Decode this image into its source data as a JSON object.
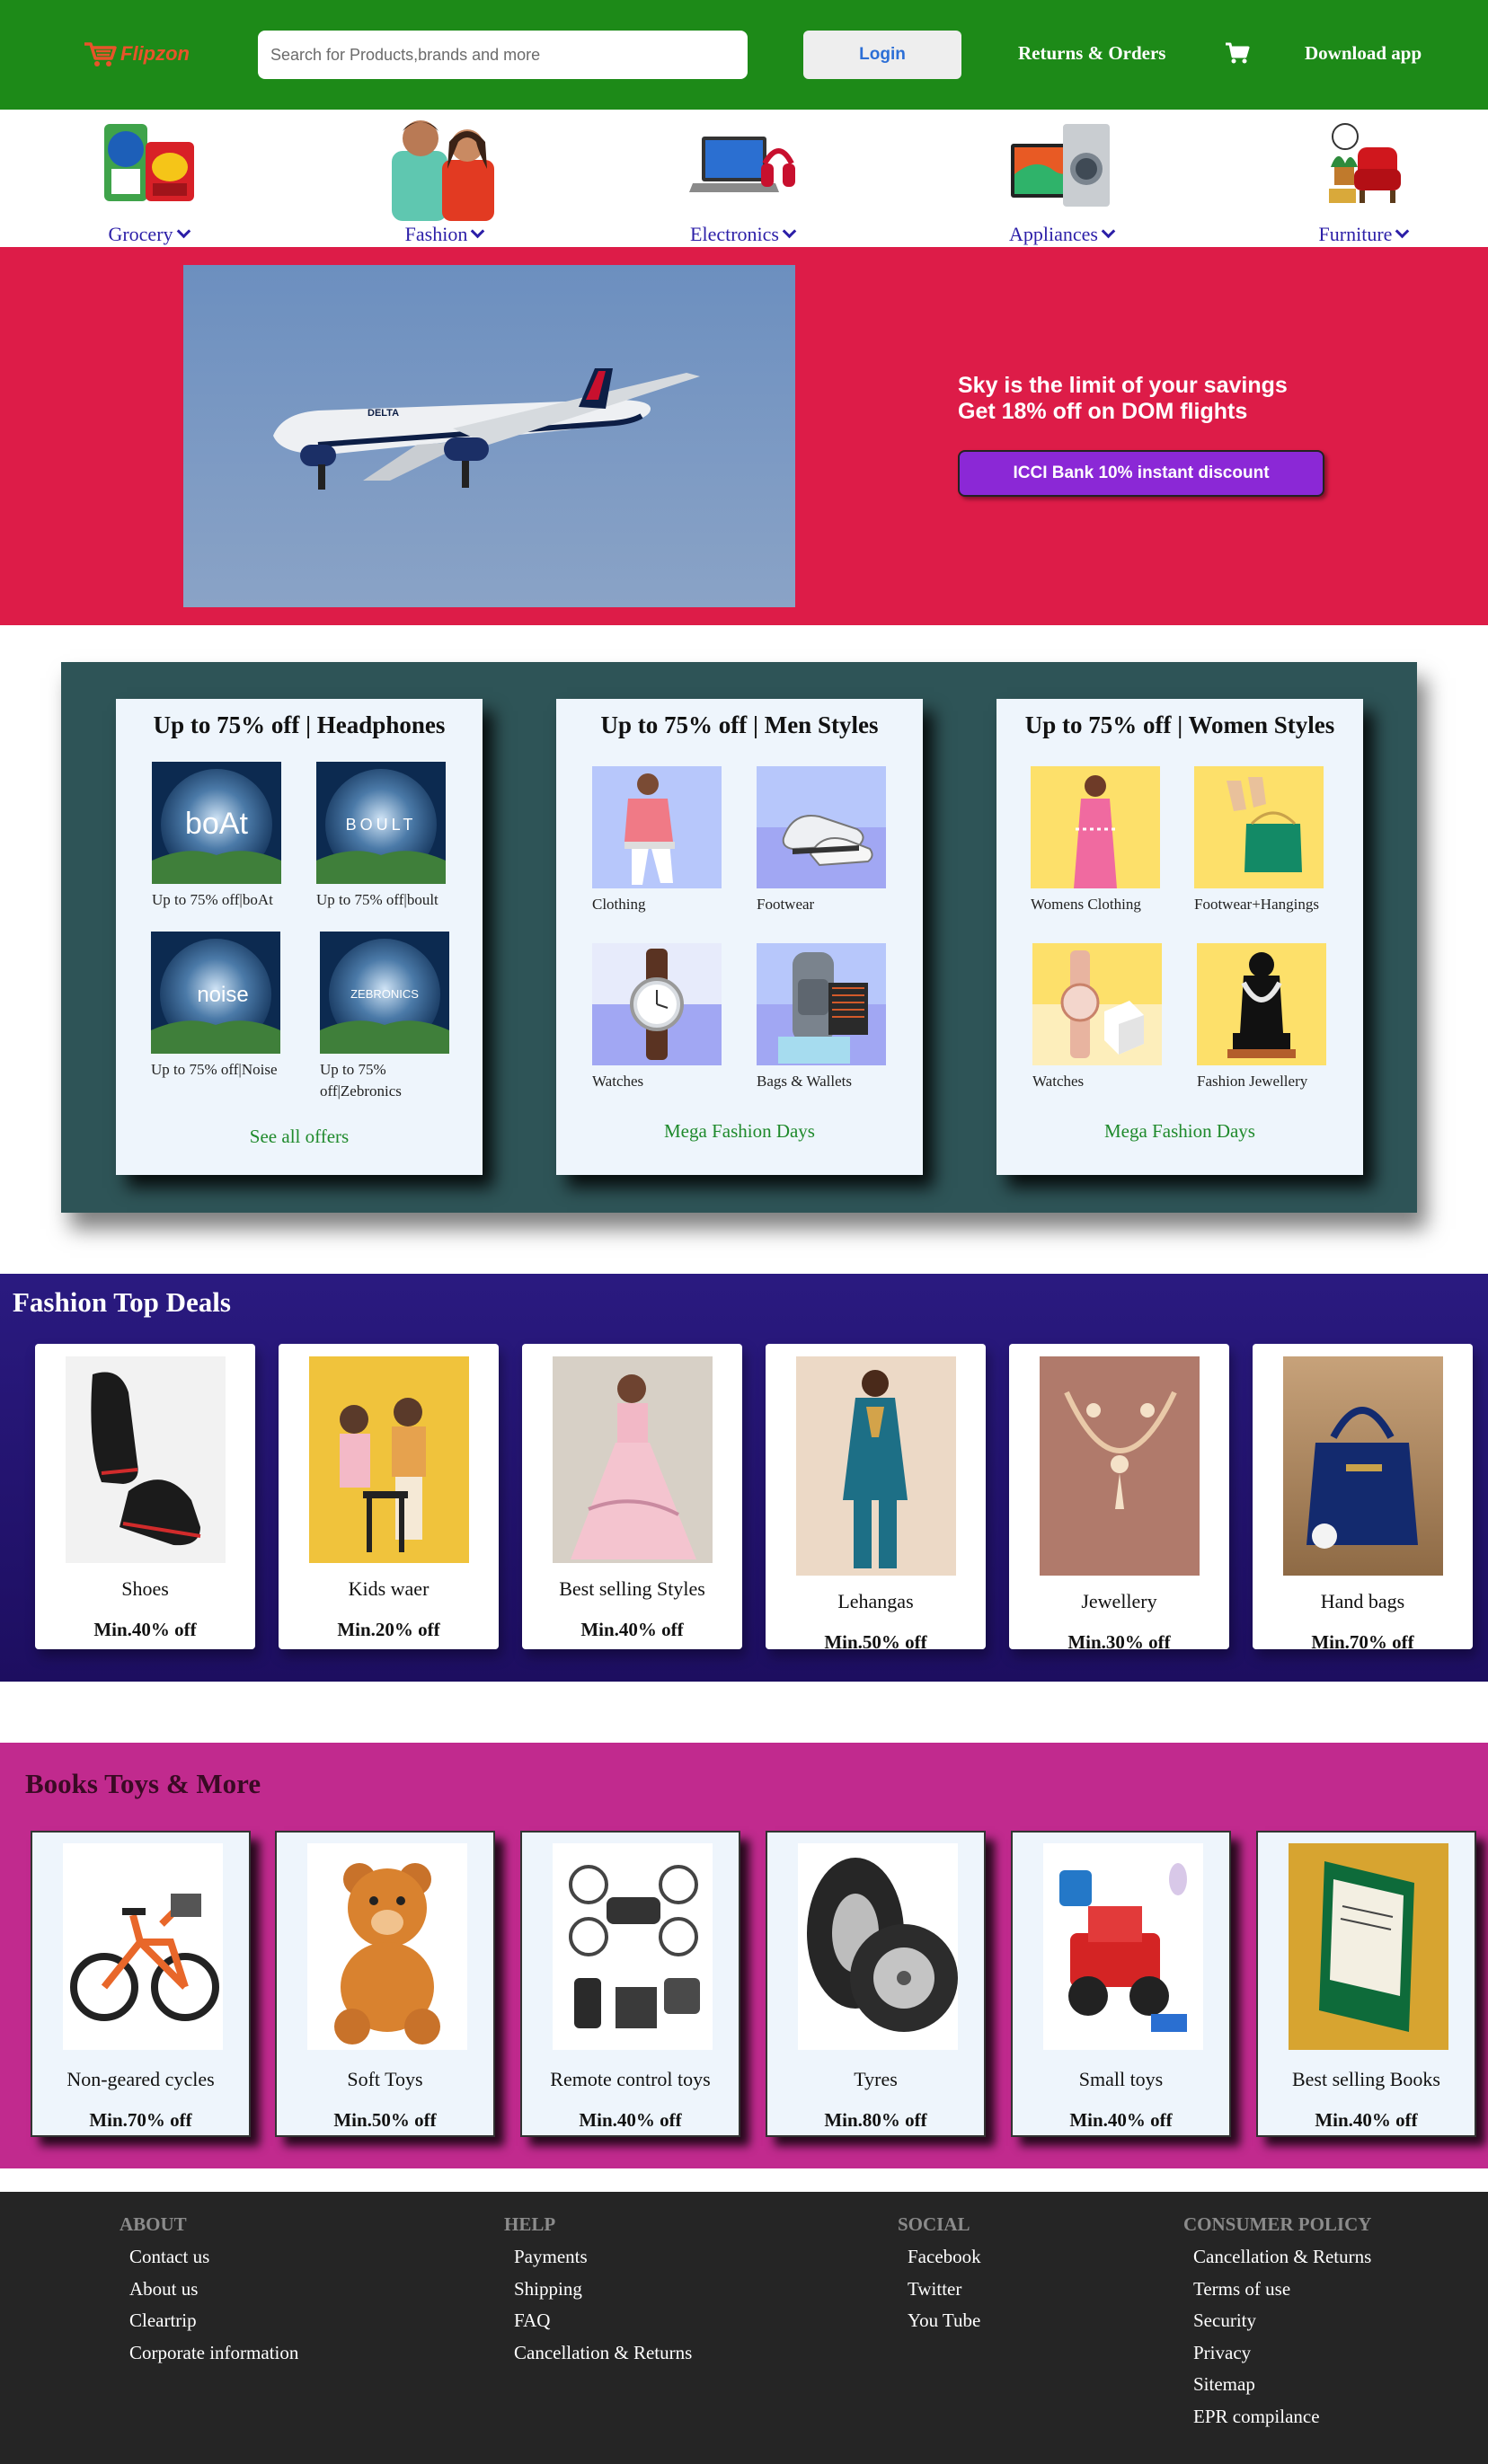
{
  "header": {
    "logo_text": "Flipzon",
    "search_placeholder": "Search for Products,brands and more",
    "login_label": "Login",
    "returns_label": "Returns & Orders",
    "download_label": "Download app",
    "bg_color": "#1d8a18"
  },
  "categories": [
    {
      "label": "Grocery",
      "icon": "grocery-image"
    },
    {
      "label": "Fashion",
      "icon": "fashion-image"
    },
    {
      "label": "Electronics",
      "icon": "electronics-image"
    },
    {
      "label": "Appliances",
      "icon": "appliances-image"
    },
    {
      "label": "Furniture",
      "icon": "furniture-image"
    }
  ],
  "banner": {
    "line1": "Sky is the limit of your savings",
    "line2": "Get 18% off on DOM flights",
    "button": "ICCI Bank 10% instant discount",
    "bg_color": "#dd1c48",
    "image_text": "DELTA"
  },
  "offers": [
    {
      "title": "Up to 75% off | Headphones",
      "items": [
        {
          "caption": "Up to 75% off|boAt",
          "brand": "boAt"
        },
        {
          "caption": "Up to 75% off|boult",
          "brand": "BOULT"
        },
        {
          "caption": "Up to 75% off|Noise",
          "brand": "noise"
        },
        {
          "caption": "Up to 75% off|Zebronics",
          "brand": "ZEBRONICS"
        }
      ],
      "link": "See all offers"
    },
    {
      "title": "Up to 75% off | Men Styles",
      "items": [
        {
          "caption": "Clothing"
        },
        {
          "caption": "Footwear"
        },
        {
          "caption": "Watches"
        },
        {
          "caption": "Bags & Wallets"
        }
      ],
      "link": "Mega Fashion Days"
    },
    {
      "title": "Up to 75% off | Women Styles",
      "items": [
        {
          "caption": "Womens Clothing"
        },
        {
          "caption": "Footwear+Hangings"
        },
        {
          "caption": "Watches"
        },
        {
          "caption": "Fashion Jewellery"
        }
      ],
      "link": "Mega Fashion Days"
    }
  ],
  "fashion_deals": {
    "title": "Fashion Top Deals",
    "items": [
      {
        "name": "Shoes",
        "offer": "Min.40% off"
      },
      {
        "name": "Kids waer",
        "offer": "Min.20% off"
      },
      {
        "name": "Best selling Styles",
        "offer": "Min.40% off"
      },
      {
        "name": "Lehangas",
        "offer": "Min.50% off"
      },
      {
        "name": "Jewellery",
        "offer": "Min.30% off"
      },
      {
        "name": "Hand bags",
        "offer": "Min.70% off"
      }
    ]
  },
  "books_toys": {
    "title": "Books Toys & More",
    "items": [
      {
        "name": "Non-geared cycles",
        "offer": "Min.70% off"
      },
      {
        "name": "Soft Toys",
        "offer": "Min.50% off"
      },
      {
        "name": "Remote control toys",
        "offer": "Min.40% off"
      },
      {
        "name": "Tyres",
        "offer": "Min.80% off"
      },
      {
        "name": "Small toys",
        "offer": "Min.40% off"
      },
      {
        "name": "Best selling Books",
        "offer": "Min.40% off"
      }
    ]
  },
  "footer": {
    "columns": [
      {
        "heading": "ABOUT",
        "links": [
          "Contact us",
          "About us",
          "Cleartrip",
          "Corporate information"
        ]
      },
      {
        "heading": "HELP",
        "links": [
          "Payments",
          "Shipping",
          "FAQ",
          "Cancellation & Returns"
        ]
      },
      {
        "heading": "SOCIAL",
        "links": [
          "Facebook",
          "Twitter",
          "You Tube"
        ]
      },
      {
        "heading": "CONSUMER POLICY",
        "links": [
          "Cancellation & Returns",
          "Terms of use",
          "Security",
          "Privacy",
          "Sitemap",
          "EPR compilance"
        ]
      }
    ]
  }
}
